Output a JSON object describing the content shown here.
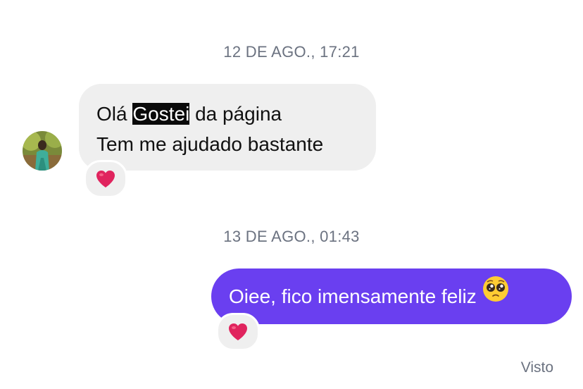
{
  "thread": {
    "timestamp_1": "12 DE AGO., 17:21",
    "timestamp_2": "13 DE AGO., 01:43",
    "incoming": {
      "line1_prefix": "Olá ",
      "line1_highlight": "Gostei",
      "line1_suffix": " da página",
      "line2": "Tem me ajudado bastante",
      "reaction_icon": "red-heart-icon"
    },
    "outgoing": {
      "text": "Oiee, fico imensamente feliz",
      "emoji_icon": "pleading-face-emoji-icon",
      "reaction_icon": "red-heart-icon"
    },
    "seen_label": "Visto"
  },
  "colors": {
    "outgoing_bubble": "#6a3ff0",
    "incoming_bubble": "#efefef",
    "heart": "#e0245e",
    "meta_text": "#6b7280"
  }
}
